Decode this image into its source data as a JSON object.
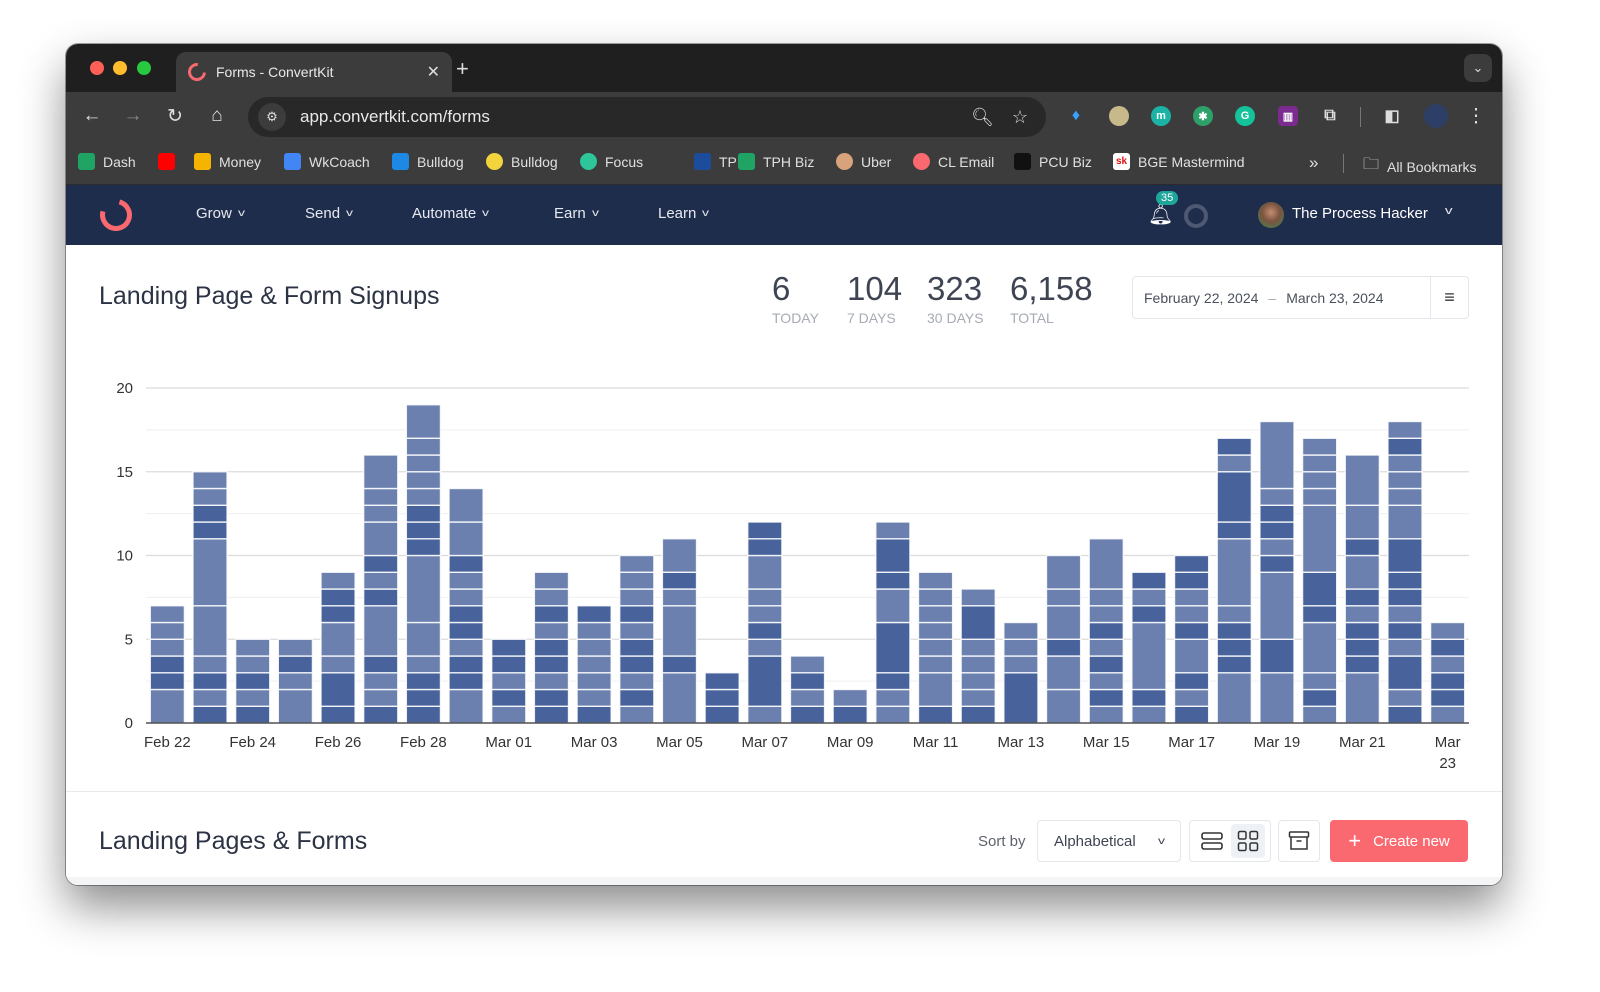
{
  "browser": {
    "tab_title": "Forms - ConvertKit",
    "tab_close": "✕",
    "new_tab": "+",
    "url": "app.convertkit.com/forms",
    "bookmarks": [
      {
        "label": "Dash",
        "icon": "sheets-icon",
        "color": "#1fa463"
      },
      {
        "label": "",
        "icon": "youtube-icon",
        "color": "#ff0000"
      },
      {
        "label": "Money",
        "icon": "drive-icon",
        "color": "#f4b400"
      },
      {
        "label": "WkCoach",
        "icon": "docs-icon",
        "color": "#4285f4"
      },
      {
        "label": "Bulldog",
        "icon": "bulldog-k-icon",
        "color": "#1e88e5"
      },
      {
        "label": "Bulldog",
        "icon": "bulldog-badge-icon",
        "color": "#f2d43d"
      },
      {
        "label": "Focus",
        "icon": "focus-icon",
        "color": "#2ec59a"
      },
      {
        "label": "TPH",
        "icon": "tph-cube-icon",
        "color": "#1c4d9c"
      },
      {
        "label": "TPH Biz",
        "icon": "sheets-icon",
        "color": "#1fa463"
      },
      {
        "label": "Uber",
        "icon": "face-icon",
        "color": "#d8a27a"
      },
      {
        "label": "CL Email",
        "icon": "convertkit-icon",
        "color": "#fb6970"
      },
      {
        "label": "PCU Biz",
        "icon": "pcu-icon",
        "color": "#111111"
      },
      {
        "label": "BGE Mastermind",
        "icon": "sk-icon",
        "color": "#ffffff"
      }
    ],
    "bookmarks_overflow": "»",
    "all_bookmarks": "All Bookmarks"
  },
  "nav": {
    "menus": [
      "Grow",
      "Send",
      "Automate",
      "Earn",
      "Learn"
    ],
    "notification_count": "35",
    "user_name": "The Process Hacker"
  },
  "header": {
    "title": "Landing Page & Form Signups",
    "stats": [
      {
        "value": "6",
        "label": "TODAY"
      },
      {
        "value": "104",
        "label": "7 DAYS"
      },
      {
        "value": "323",
        "label": "30 DAYS"
      },
      {
        "value": "6,158",
        "label": "TOTAL"
      }
    ],
    "date_start": "February 22, 2024",
    "date_sep": "–",
    "date_end": "March 23, 2024"
  },
  "chart_data": {
    "type": "bar",
    "stacked": true,
    "title": "",
    "xlabel": "",
    "ylabel": "",
    "ylim": [
      0,
      20
    ],
    "yticks": [
      0,
      5,
      10,
      15,
      20
    ],
    "grid": true,
    "colors": {
      "dark": "#48639c",
      "light": "#6b80af"
    },
    "categories": [
      "Feb 22",
      "Feb 23",
      "Feb 24",
      "Feb 25",
      "Feb 26",
      "Feb 27",
      "Feb 28",
      "Feb 29",
      "Mar 01",
      "Mar 02",
      "Mar 03",
      "Mar 04",
      "Mar 05",
      "Mar 06",
      "Mar 07",
      "Mar 08",
      "Mar 09",
      "Mar 10",
      "Mar 11",
      "Mar 12",
      "Mar 13",
      "Mar 14",
      "Mar 15",
      "Mar 16",
      "Mar 17",
      "Mar 18",
      "Mar 19",
      "Mar 20",
      "Mar 21",
      "Mar 22",
      "Mar 23"
    ],
    "xtick_labels": [
      "Feb 22",
      "",
      "Feb 24",
      "",
      "Feb 26",
      "",
      "Feb 28",
      "",
      "Mar 01",
      "",
      "Mar 03",
      "",
      "Mar 05",
      "",
      "Mar 07",
      "",
      "Mar 09",
      "",
      "Mar 11",
      "",
      "Mar 13",
      "",
      "Mar 15",
      "",
      "Mar 17",
      "",
      "Mar 19",
      "",
      "Mar 21",
      "",
      "Mar 23"
    ],
    "values": [
      7,
      15,
      5,
      5,
      9,
      16,
      20,
      14,
      5,
      9,
      7,
      10,
      11,
      3,
      12,
      4,
      2,
      11,
      9,
      8,
      6,
      10,
      12,
      9,
      10,
      18,
      18,
      17,
      16,
      19,
      6
    ],
    "segments": [
      "2l 1d 1d 1l 1l 1l",
      "1d 1l 1d 1l 3l 4l 1d 1d 1l 1l",
      "1d 1l 1d 1l 1l",
      "2l 1l 1d 1l",
      "1d 2d 1l 2l 1d 1d 1l",
      "1d 1l 1l 1d 3l 1d 1l 1d 2l 1l 1l 2l",
      "1d 1d 1d 1l 2l 4l 1d 1d 1d 1l 1l 1l 1l 2l",
      "2l 1d 1d 1l 1d 1d 1l 1l 1d 2l 2l",
      "1l 1d 1l 1d 1d",
      "1d 1d 1l 1d 1d 1l 1d 1l 1l",
      "1d 1l 1l 1l 1l 1l 1d",
      "1l 1d 1l 1d 1d 1l 1d 1l 1l 1l",
      "3l 1d 3l 1l 1d 2l",
      "1d 1d 1d",
      "1l 3d 1l 1d 1l 1l 2l 1d 1d",
      "1d 1l 1d 1l",
      "1d 1l",
      "1l 1l 1d 3d 2l 1d 2d 1l",
      "1d 2l 1l 1l 1l 1l 1l 1l",
      "1d 1l 1l 1l 1l 2d 1l",
      "3d 1l 1l 1l",
      "2l 2l 1d 2l 1l 2l",
      "1l 1d 1l 1d 1l 1d 1l 1l 3l",
      "1l 1d 4l 1d 1l 1d",
      "1d 1l 1d 2l 1d 1l 1l 1d 1d",
      "3l 1d 1d 1d 1l 4l 1d 3d 1l 1d",
      "3l 2d 4l 1d 1l 1d 1d 1l 4l",
      "1l 1d 1l 3l 1d 2d 4l 1l 1l 1l 1l",
      "3l 1d 1d 1d 1l 1d 2l 1d 2l 3l",
      "1d 1l 2d 1l 1d 1l 1d 1d 2d 2l 1l 1l 1l 1d 1l",
      "1l 1d 1d 1l 1d 1l"
    ]
  },
  "list_section": {
    "title": "Landing Pages & Forms",
    "sort_label": "Sort by",
    "sort_value": "Alphabetical",
    "create_label": "Create new"
  }
}
